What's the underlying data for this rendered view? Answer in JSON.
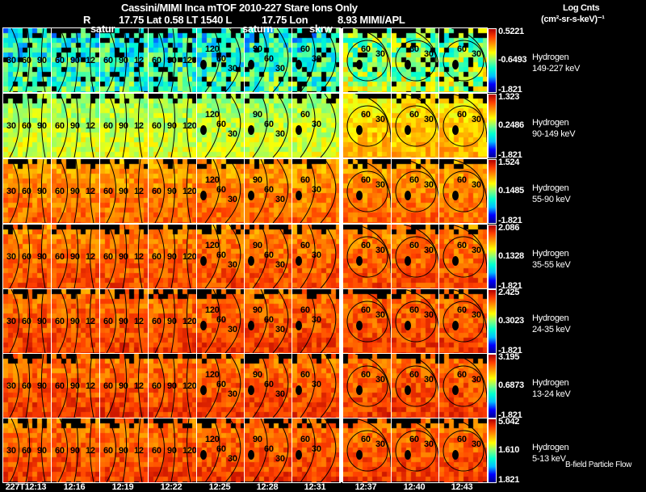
{
  "header": {
    "title": "Cassini/MIMI Inca mTOF  2010-227   Stare   Ions Only",
    "r_label": "R",
    "lat_text": "17.75 Lat 0.58 LT 1540 L",
    "lon_text": "17.75 Lon",
    "source_text": "8.93  MIMI/APL",
    "overlay_1": "satur",
    "overlay_2": "saturn",
    "overlay_3": "skrw"
  },
  "units": {
    "line1": "Log Cnts",
    "line2": "(cm²-sr-s-keV)⁻¹"
  },
  "rows": [
    {
      "species": "Hydrogen",
      "energy": "149-227 keV",
      "max": "0.5221",
      "mid": "-0.6493",
      "min": "-1.821",
      "level": 0.35
    },
    {
      "species": "Hydrogen",
      "energy": "90-149 keV",
      "max": "1.323",
      "mid": "0.2486",
      "min": "-1.821",
      "level": 0.52
    },
    {
      "species": "Hydrogen",
      "energy": "55-90 keV",
      "max": "1.524",
      "mid": "0.1485",
      "min": "-1.821",
      "level": 0.74
    },
    {
      "species": "Hydrogen",
      "energy": "35-55 keV",
      "max": "2.086",
      "mid": "0.1328",
      "min": "-1.821",
      "level": 0.78
    },
    {
      "species": "Hydrogen",
      "energy": "24-35 keV",
      "max": "2.425",
      "mid": "0.3023",
      "min": "-1.821",
      "level": 0.8
    },
    {
      "species": "Hydrogen",
      "energy": "13-24 keV",
      "max": "3.195",
      "mid": "0.6873",
      "min": "-1.821",
      "level": 0.8
    },
    {
      "species": "Hydrogen",
      "energy": "5-13 keV",
      "max": "5.042",
      "mid": "1.610",
      "min": "1.821",
      "level": 0.8
    }
  ],
  "times": [
    "227T12:13",
    "12:16",
    "12:19",
    "12:22",
    "12:25",
    "12:28",
    "12:31",
    "12:37",
    "12:40",
    "12:43"
  ],
  "contour_labels": [
    [
      "30",
      "60",
      "90"
    ],
    [
      "60",
      "90",
      "12"
    ],
    [
      "60",
      "90",
      "12"
    ],
    [
      "60",
      "90",
      "120"
    ],
    [
      "120",
      "60",
      "30"
    ],
    [
      "90",
      "60",
      "30"
    ],
    [
      "60",
      "30"
    ],
    [
      "60",
      "30"
    ],
    [
      "60",
      "30"
    ],
    [
      "60",
      "30"
    ]
  ],
  "footer": "B-field Particle Flow",
  "colormap": [
    "#00008f",
    "#0000ff",
    "#00bfff",
    "#00ffd0",
    "#7fff7f",
    "#ffff00",
    "#ff9f00",
    "#ff3f00",
    "#b00000"
  ]
}
